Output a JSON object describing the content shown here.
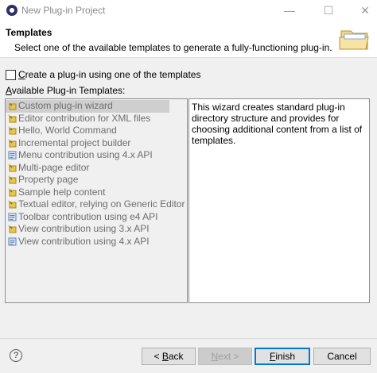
{
  "window": {
    "title": "New Plug-in Project",
    "minimize": "—",
    "maximize": "☐",
    "close": "✕"
  },
  "header": {
    "title": "Templates",
    "description": "Select one of the available templates to generate a fully-functioning plug-in."
  },
  "create_checkbox": {
    "label_prefix": "",
    "label_mnemonic": "C",
    "label_rest": "reate a plug-in using one of the templates",
    "checked": false
  },
  "available_label": {
    "mnemonic": "A",
    "rest": "vailable Plug-in Templates:"
  },
  "templates": [
    {
      "label": "Custom plug-in wizard",
      "icon": "wizard-icon",
      "selected": true
    },
    {
      "label": "Editor contribution for XML files",
      "icon": "wizard-icon"
    },
    {
      "label": "Hello, World Command",
      "icon": "wizard-icon"
    },
    {
      "label": "Incremental project builder",
      "icon": "wizard-icon"
    },
    {
      "label": "Menu contribution using 4.x API",
      "icon": "template-icon"
    },
    {
      "label": "Multi-page editor",
      "icon": "wizard-icon"
    },
    {
      "label": "Property page",
      "icon": "wizard-icon"
    },
    {
      "label": "Sample help content",
      "icon": "wizard-icon"
    },
    {
      "label": "Textual editor, relying on Generic Editor",
      "icon": "wizard-icon"
    },
    {
      "label": "Toolbar contribution using e4 API",
      "icon": "template-icon"
    },
    {
      "label": "View contribution using 3.x API",
      "icon": "wizard-icon"
    },
    {
      "label": "View contribution using 4.x API",
      "icon": "template-icon"
    }
  ],
  "description_text": "This wizard creates standard plug-in directory structure and provides for choosing additional content from a list of templates.",
  "buttons": {
    "help": "?",
    "back_prefix": "< ",
    "back_mnemonic": "B",
    "back_rest": "ack",
    "next_mnemonic": "N",
    "next_rest": "ext >",
    "finish_mnemonic": "F",
    "finish_rest": "inish",
    "cancel": "Cancel"
  }
}
